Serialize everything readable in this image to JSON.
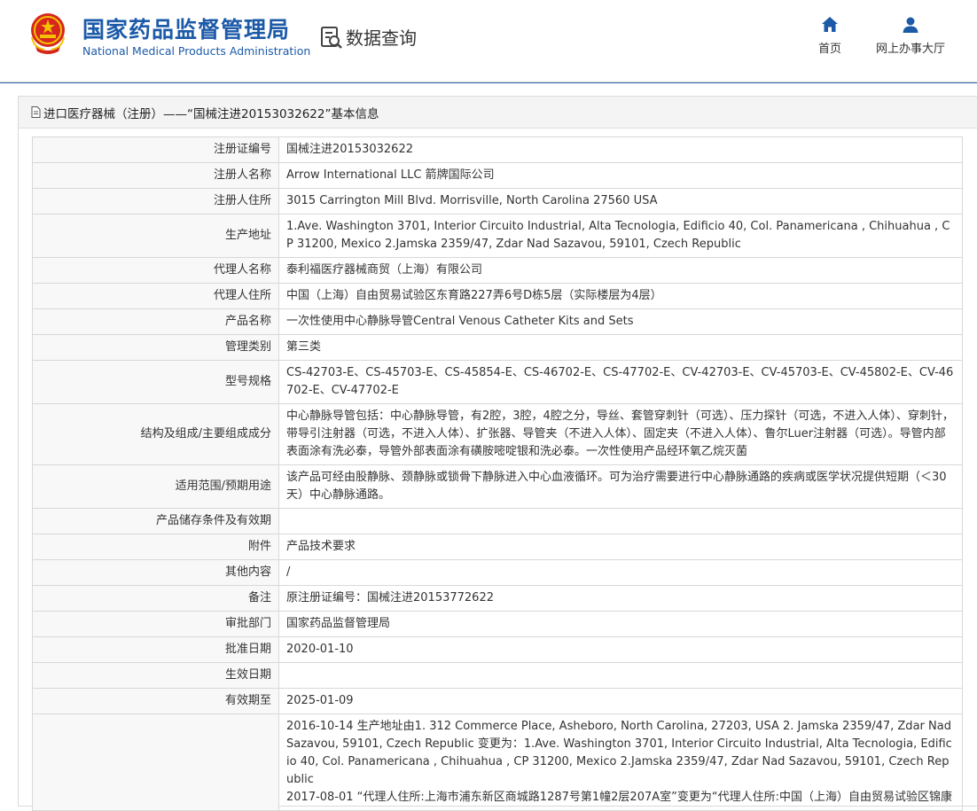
{
  "header": {
    "site_title": "国家药品监督管理局",
    "site_subtitle": "National Medical Products Administration",
    "query_label": "数据查询",
    "nav": [
      {
        "label": "首页",
        "icon": "home-icon"
      },
      {
        "label": "网上办事大厅",
        "icon": "user-icon"
      }
    ],
    "colors": {
      "brand": "#1c5aa8",
      "rule": "#2a62b5"
    }
  },
  "panel": {
    "title": "进口医疗器械（注册）——“国械注进20153032622”基本信息"
  },
  "rows": [
    {
      "label": "注册证编号",
      "value": "国械注进20153032622"
    },
    {
      "label": "注册人名称",
      "value": "Arrow International LLC 箭牌国际公司"
    },
    {
      "label": "注册人住所",
      "value": "3015 Carrington Mill Blvd. Morrisville, North Carolina 27560 USA"
    },
    {
      "label": "生产地址",
      "value": "1.Ave. Washington 3701, Interior Circuito Industrial, Alta Tecnologia, Edificio 40, Col. Panamericana , Chihuahua , CP 31200, Mexico 2.Jamska 2359/47, Zdar Nad Sazavou, 59101, Czech Republic"
    },
    {
      "label": "代理人名称",
      "value": "泰利福医疗器械商贸（上海）有限公司"
    },
    {
      "label": "代理人住所",
      "value": "中国（上海）自由贸易试验区东育路227弄6号D栋5层（实际楼层为4层）"
    },
    {
      "label": "产品名称",
      "value": "一次性使用中心静脉导管Central Venous Catheter Kits and Sets"
    },
    {
      "label": "管理类别",
      "value": "第三类"
    },
    {
      "label": "型号规格",
      "value": "CS-42703-E、CS-45703-E、CS-45854-E、CS-46702-E、CS-47702-E、CV-42703-E、CV-45703-E、CV-45802-E、CV-46702-E、CV-47702-E"
    },
    {
      "label": "结构及组成/主要组成成分",
      "value": "中心静脉导管包括：中心静脉导管，有2腔，3腔，4腔之分，导丝、套管穿刺针（可选）、压力探针（可选，不进入人体）、穿刺针，带导引注射器（可选，不进入人体）、扩张器、导管夹（不进入人体）、固定夹（不进入人体）、鲁尔Luer注射器（可选）。导管内部表面涂有洗必泰，导管外部表面涂有磺胺嘧啶银和洗必泰。一次性使用产品经环氧乙烷灭菌"
    },
    {
      "label": "适用范围/预期用途",
      "value": "该产品可经由股静脉、颈静脉或锁骨下静脉进入中心血液循环。可为治疗需要进行中心静脉通路的疾病或医学状况提供短期（＜30天）中心静脉通路。"
    },
    {
      "label": "产品储存条件及有效期",
      "value": ""
    },
    {
      "label": "附件",
      "value": "产品技术要求"
    },
    {
      "label": "其他内容",
      "value": "/"
    },
    {
      "label": "备注",
      "value": "原注册证编号：国械注进20153772622"
    },
    {
      "label": "审批部门",
      "value": "国家药品监督管理局"
    },
    {
      "label": "批准日期",
      "value": "2020-01-10"
    },
    {
      "label": "生效日期",
      "value": ""
    },
    {
      "label": "有效期至",
      "value": "2025-01-09"
    },
    {
      "label": "",
      "value": "2016-10-14 生产地址由1. 312 Commerce Place, Asheboro, North Carolina, 27203, USA 2. Jamska 2359/47, Zdar Nad Sazavou, 59101, Czech Republic 变更为：1.Ave. Washington 3701, Interior Circuito Industrial, Alta Tecnologia, Edificio 40, Col. Panamericana , Chihuahua , CP 31200, Mexico 2.Jamska 2359/47, Zdar Nad Sazavou, 59101, Czech Republic\n2017-08-01 “代理人住所:上海市浦东新区商城路1287号第1幢2层207A室”变更为“代理人住所:中国（上海）自由贸易试验区锦康"
    }
  ]
}
